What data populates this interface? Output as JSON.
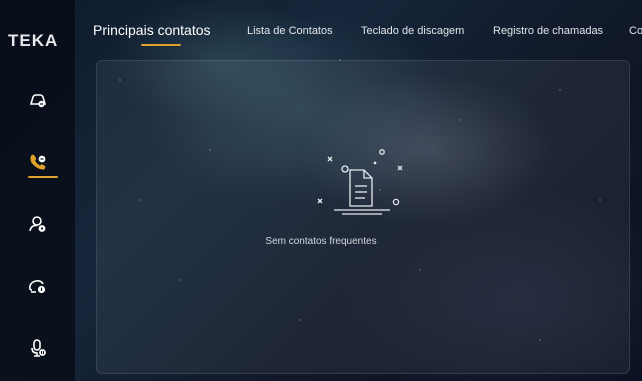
{
  "brand": {
    "logo_text": "TEKA"
  },
  "tabs": [
    {
      "label": "Principais contatos",
      "active": true
    },
    {
      "label": "Lista de Contatos",
      "active": false
    },
    {
      "label": "Teclado de discagem",
      "active": false
    },
    {
      "label": "Registro de chamadas",
      "active": false
    },
    {
      "label": "Co",
      "active": false
    }
  ],
  "sidebar": {
    "items": [
      {
        "icon": "car-connect-icon",
        "active": false
      },
      {
        "icon": "phone-icon",
        "active": true
      },
      {
        "icon": "user-settings-icon",
        "active": false
      },
      {
        "icon": "music-cloud-icon",
        "active": false
      },
      {
        "icon": "voice-assistant-icon",
        "active": false
      }
    ]
  },
  "empty_state": {
    "message": "Sem contatos frequentes"
  },
  "colors": {
    "accent": "#e0a12a",
    "text": "#ffffff"
  }
}
